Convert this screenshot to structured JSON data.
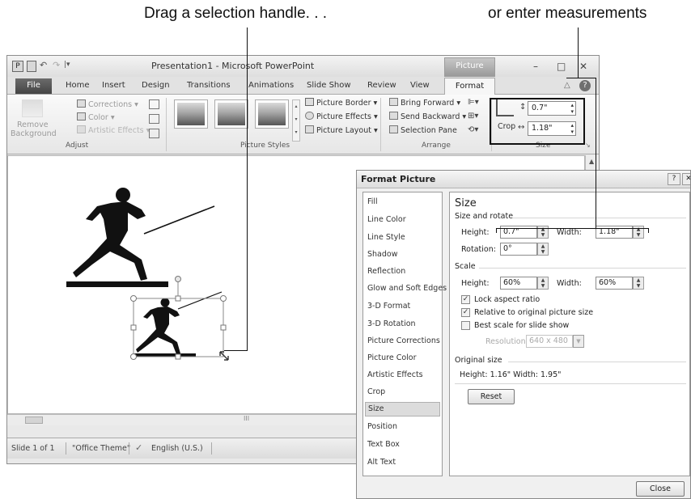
{
  "callouts": {
    "drag": "Drag a selection handle. . .",
    "enter": "or enter measurements"
  },
  "window": {
    "title": "Presentation1  -  Microsoft PowerPoint",
    "context_tab": "Picture Tools",
    "controls": {
      "minimize": "–",
      "maximize": "□",
      "close": "✕",
      "help": "?",
      "collapse": "△"
    }
  },
  "tabs": [
    "File",
    "Home",
    "Insert",
    "Design",
    "Transitions",
    "Animations",
    "Slide Show",
    "Review",
    "View",
    "Format"
  ],
  "ribbon": {
    "adjust": {
      "remove_bg_line1": "Remove",
      "remove_bg_line2": "Background",
      "corrections": "Corrections ▾",
      "color": "Color ▾",
      "artistic": "Artistic Effects ▾",
      "label": "Adjust"
    },
    "styles": {
      "border": "Picture Border ▾",
      "effects": "Picture Effects ▾",
      "layout": "Picture Layout ▾",
      "label": "Picture Styles"
    },
    "arrange": {
      "forward": "Bring Forward ▾",
      "backward": "Send Backward ▾",
      "pane": "Selection Pane",
      "label": "Arrange"
    },
    "size": {
      "crop": "Crop",
      "height": "0.7\"",
      "width": "1.18\"",
      "label": "Size"
    }
  },
  "status": {
    "slide": "Slide 1 of 1",
    "theme": "\"Office Theme\"",
    "language": "English (U.S.)"
  },
  "hscroll_mark": "III",
  "dialog": {
    "title": "Format Picture",
    "help": "?",
    "close_x": "✕",
    "categories": [
      "Fill",
      "Line Color",
      "Line Style",
      "Shadow",
      "Reflection",
      "Glow and Soft Edges",
      "3-D Format",
      "3-D Rotation",
      "Picture Corrections",
      "Picture Color",
      "Artistic Effects",
      "Crop",
      "Size",
      "Position",
      "Text Box",
      "Alt Text"
    ],
    "selected_category": "Size",
    "size": {
      "heading": "Size",
      "size_rotate": "Size and rotate",
      "height_label": "Height:",
      "height_value": "0.7\"",
      "width_label": "Width:",
      "width_value": "1.18\"",
      "rotation_label": "Rotation:",
      "rotation_value": "0°",
      "scale": "Scale",
      "scale_height_label": "Height:",
      "scale_height_value": "60%",
      "scale_width_label": "Width:",
      "scale_width_value": "60%",
      "lock_aspect": "Lock aspect ratio",
      "lock_aspect_checked": true,
      "relative": "Relative to original picture size",
      "relative_checked": true,
      "best_scale": "Best scale for slide show",
      "best_scale_checked": false,
      "resolution_label": "Resolution",
      "resolution_value": "640 x 480",
      "original_size": "Original size",
      "original_dims": "Height:  1.16\"   Width:  1.95\"",
      "reset": "Reset"
    },
    "close_button": "Close"
  }
}
